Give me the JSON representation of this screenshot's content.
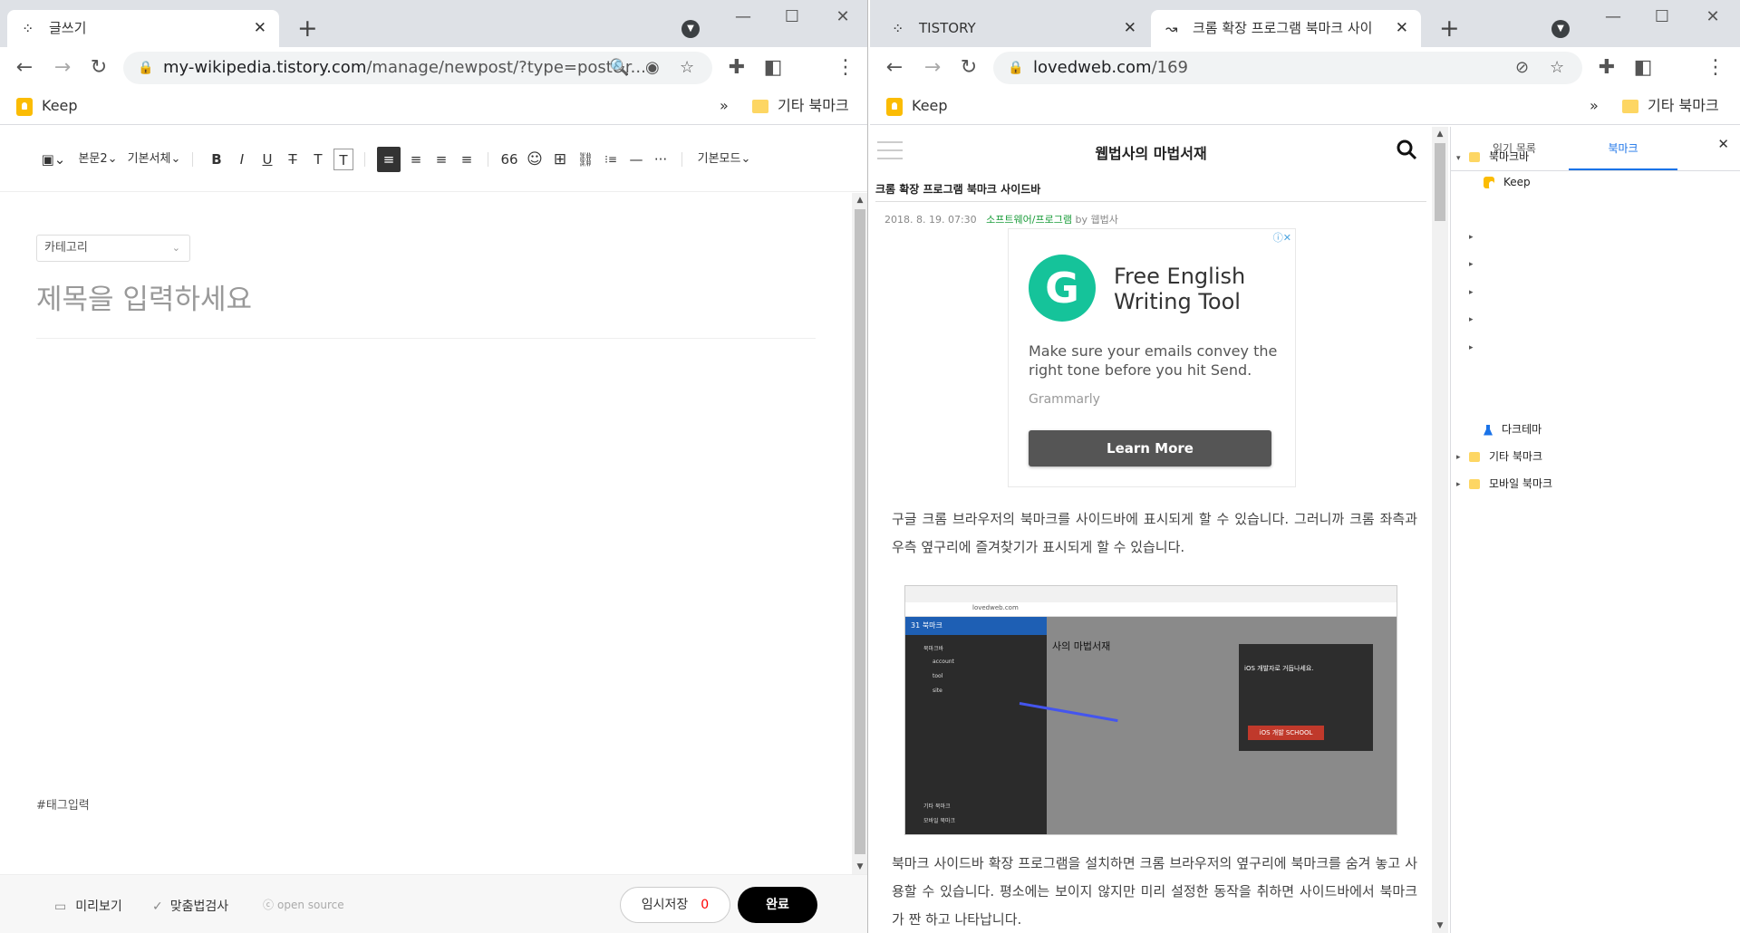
{
  "left_window": {
    "tab": {
      "title": "글쓰기",
      "close": "✕"
    },
    "newtab": "+",
    "address": {
      "domain": "my-wikipedia.tistory.com",
      "path": "/manage/newpost/?type=post&r..."
    },
    "bookmarks": {
      "keep": "Keep",
      "other": "기타 북마크",
      "overflow": "»"
    },
    "toolbar": {
      "image": "▣⌄",
      "paragraph": "본문2⌄",
      "font": "기본서체⌄",
      "bold": "B",
      "italic": "I",
      "underline": "U",
      "strike": "T",
      "textcolor": "T",
      "textbg": "T",
      "align_left": "≡",
      "align_center": "≡",
      "align_right": "≡",
      "align_justify": "≡",
      "quote": "66",
      "emoji": "☺",
      "table": "⊞",
      "link": "⛓",
      "list": "⁝≡",
      "hr": "—",
      "more": "···",
      "mode": "기본모드⌄"
    },
    "editor": {
      "category": "카테고리",
      "title_placeholder": "제목을 입력하세요",
      "tag_placeholder": "#태그입력"
    },
    "footer": {
      "preview": "미리보기",
      "spellcheck": "맞춤법검사",
      "opensource": "open source",
      "save": "임시저장",
      "save_count": "0",
      "done": "완료"
    }
  },
  "right_window": {
    "tabs": [
      {
        "title": "TISTORY",
        "close": "✕"
      },
      {
        "title": "크롬 확장 프로그램 북마크 사이",
        "close": "✕"
      }
    ],
    "newtab": "+",
    "address": {
      "domain": "lovedweb.com",
      "path": "/169"
    },
    "bookmarks": {
      "keep": "Keep",
      "other": "기타 북마크",
      "overflow": "»"
    },
    "page": {
      "blog_title": "웹법사의 마법서재",
      "post_title": "크롬 확장 프로그램 북마크 사이드바",
      "date": "2018. 8. 19. 07:30",
      "category": "소프트웨어/프로그램",
      "by": "by",
      "author": "웹법사",
      "ad": {
        "heading": "Free English Writing Tool",
        "body": "Make sure your emails convey the right tone before you hit Send.",
        "source": "Grammarly",
        "cta": "Learn More",
        "logo": "G"
      },
      "para1": "구글 크롬 브라우저의 북마크를 사이드바에 표시되게 할 수 있습니다. 그러니까 크롬 좌측과 우측 옆구리에 즐겨찾기가 표시되게 할 수 있습니다.",
      "para2": "북마크 사이드바 확장 프로그램을 설치하면 크롬 브라우저의 옆구리에 북마크를 숨겨 놓고 사용할 수 있습니다. 평소에는 보이지 않지만 미리 설정한 동작을 취하면 사이드바에서 북마크가 짠 하고 나타납니다.",
      "screenshot": {
        "url": "lovedweb.com",
        "sidebar_title": "31 북마크",
        "items": [
          "북마크바",
          "account",
          "tool",
          "site",
          "기타 북마크",
          "모바일 북마크"
        ],
        "blog": "사의 마법서재",
        "ios_title": "iOS 개발자로 거듭나세요.",
        "ios_button": "iOS 개발 SCHOOL"
      }
    },
    "side_panel": {
      "tab_reading": "읽기 목록",
      "tab_bookmarks": "북마크",
      "close": "✕",
      "tree": {
        "bookmark_bar": "북마크바",
        "keep": "Keep",
        "dark_theme": "다크테마",
        "other": "기타 북마크",
        "mobile": "모바일 북마크"
      }
    }
  }
}
